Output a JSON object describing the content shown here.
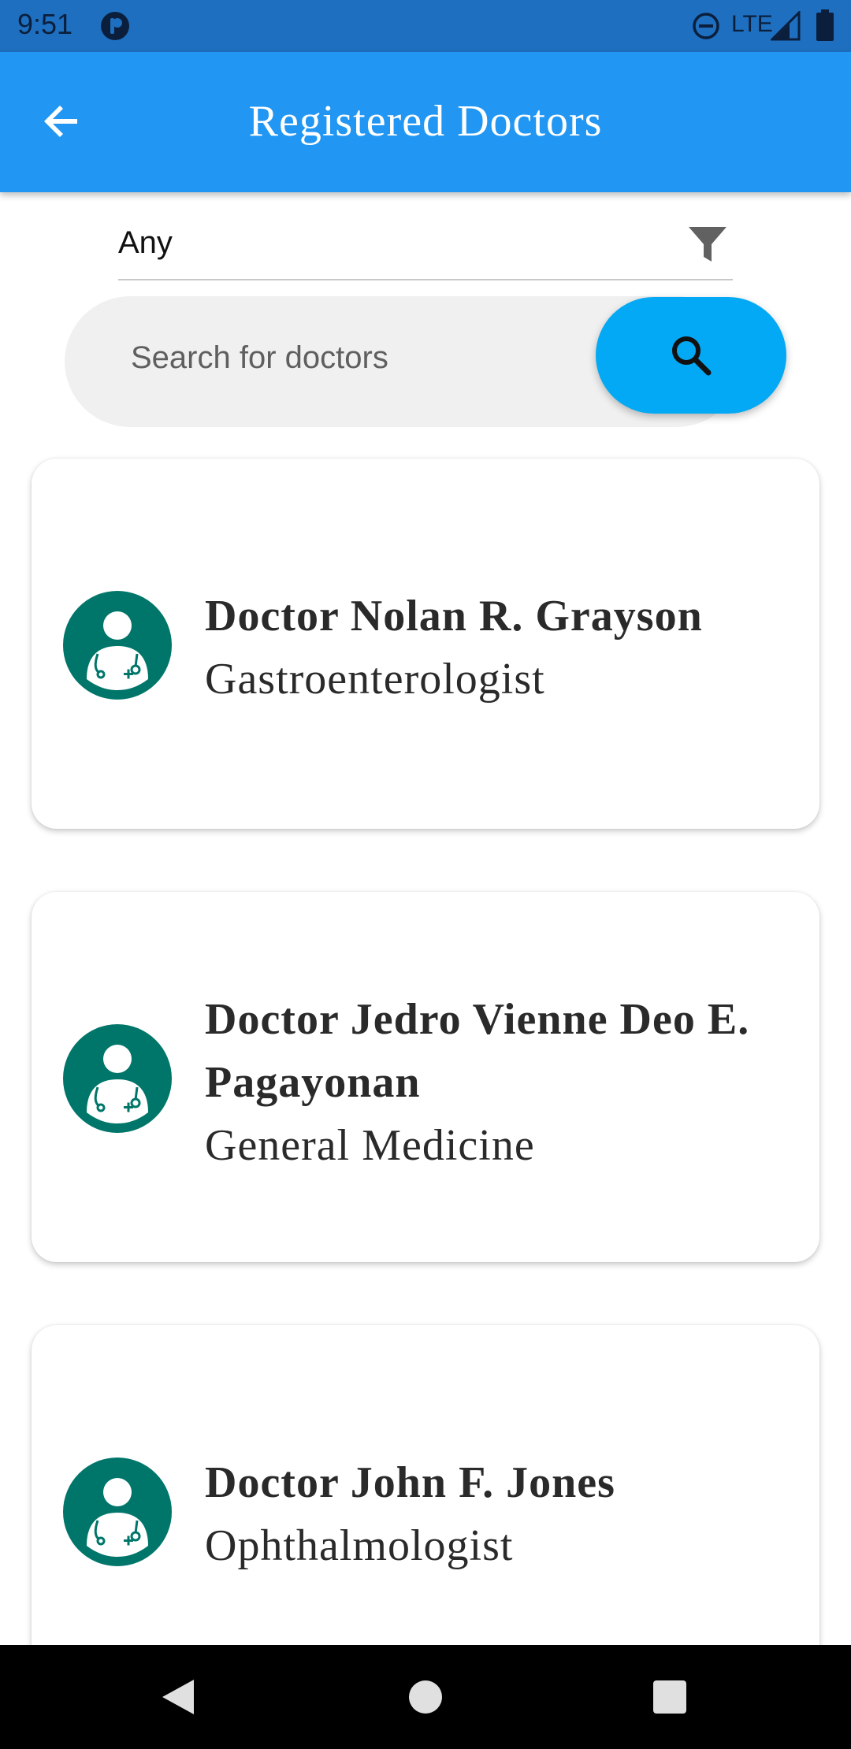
{
  "status_bar": {
    "time": "9:51",
    "network": "LTE"
  },
  "app_bar": {
    "title": "Registered Doctors",
    "back_icon": "arrow-back-icon"
  },
  "filter": {
    "selected": "Any",
    "icon": "filter-icon"
  },
  "search": {
    "placeholder": "Search for doctors",
    "value": "",
    "button_icon": "search-icon"
  },
  "doctors": [
    {
      "name": "Doctor Nolan R. Grayson",
      "specialty": "Gastroenterologist",
      "avatar_icon": "doctor-avatar-icon"
    },
    {
      "name": "Doctor Jedro Vienne Deo E. Pagayonan",
      "specialty": "General Medicine",
      "avatar_icon": "doctor-avatar-icon"
    },
    {
      "name": "Doctor John F. Jones",
      "specialty": "Ophthalmologist",
      "avatar_icon": "doctor-avatar-icon"
    }
  ],
  "nav_bar": {
    "back": "nav-back-icon",
    "home": "nav-home-icon",
    "recents": "nav-recents-icon"
  },
  "colors": {
    "status_bar": "#1e6fbf",
    "app_bar": "#2196f3",
    "search_button": "#03a9f4",
    "avatar": "#00766a",
    "nav_bar": "#000000"
  }
}
